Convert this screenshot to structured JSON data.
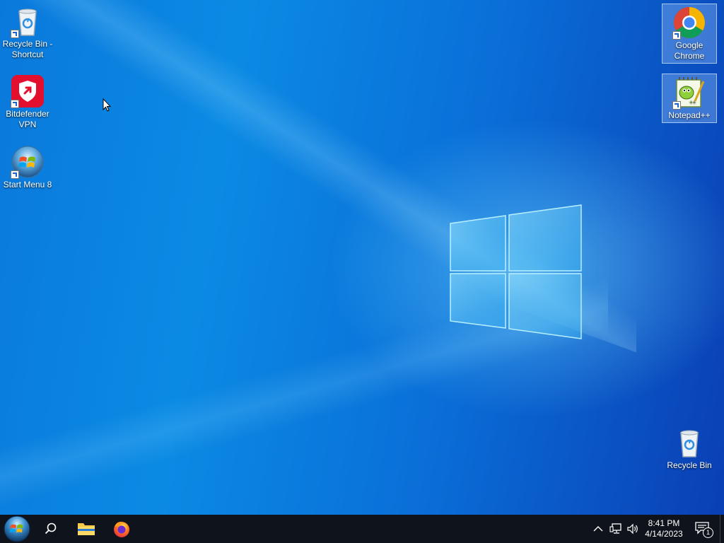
{
  "desktop": {
    "icons": [
      {
        "label": "Recycle Bin - Shortcut",
        "icon": "recycle-bin-icon"
      },
      {
        "label": "Bitdefender VPN",
        "icon": "bitdefender-vpn-icon"
      },
      {
        "label": "Start Menu 8",
        "icon": "start-menu-8-icon"
      },
      {
        "label": "Google Chrome",
        "icon": "google-chrome-icon"
      },
      {
        "label": "Notepad++",
        "icon": "notepad-plus-plus-icon"
      },
      {
        "label": "Recycle Bin",
        "icon": "recycle-bin-icon"
      }
    ],
    "colors": {
      "wallpaper_light": "#0b8ae4",
      "wallpaper_dark": "#0a3fb5",
      "logo_glow": "#78dcff"
    }
  },
  "taskbar": {
    "buttons": [
      {
        "name": "start",
        "icon": "windows-7-orb-icon"
      },
      {
        "name": "search",
        "icon": "search-icon"
      },
      {
        "name": "file-explorer",
        "icon": "folder-icon"
      },
      {
        "name": "firefox",
        "icon": "firefox-icon"
      }
    ],
    "tray": {
      "time": "8:41 PM",
      "date": "4/14/2023",
      "notification_count": "1"
    },
    "colors": {
      "background": "#0f141c"
    }
  }
}
